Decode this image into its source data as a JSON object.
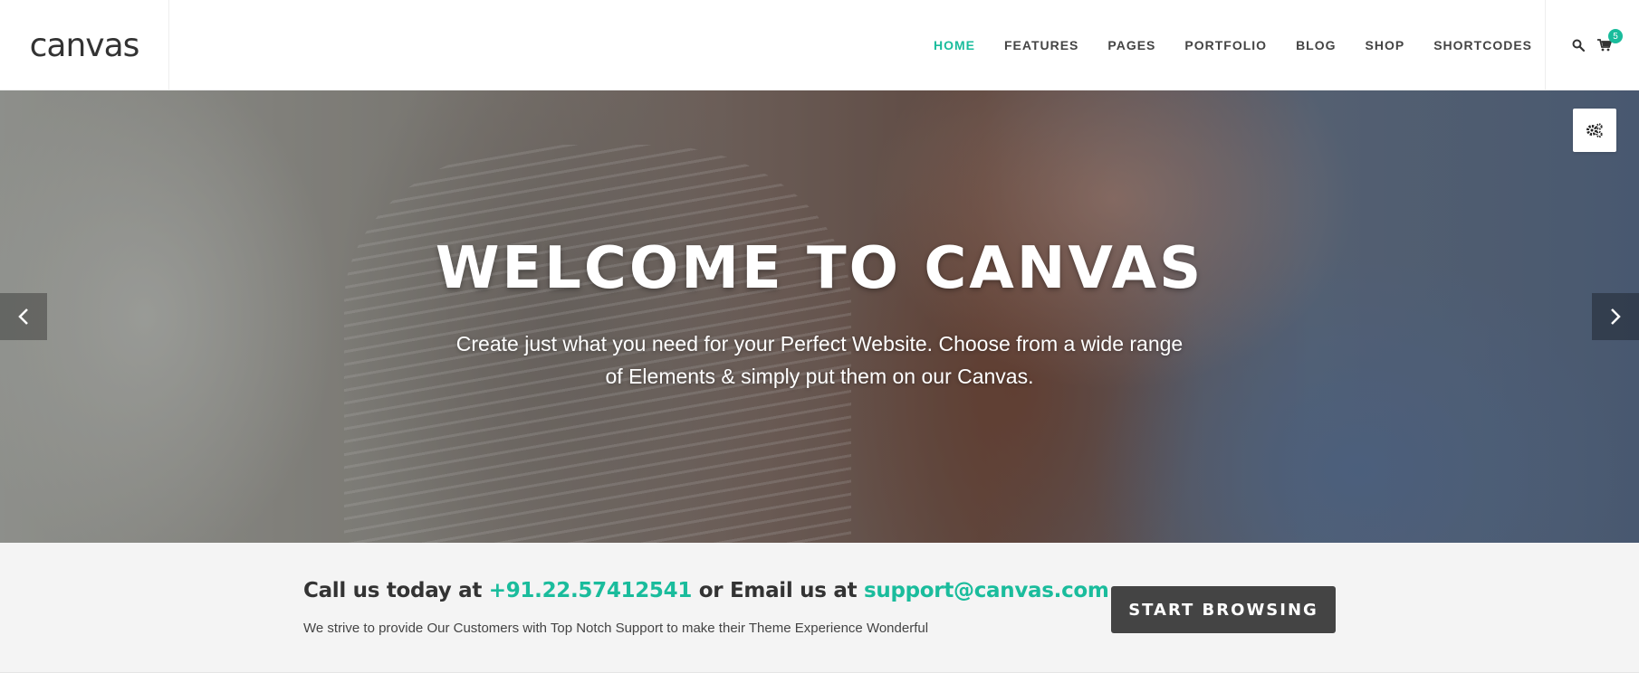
{
  "header": {
    "logo": "canvas",
    "nav": [
      {
        "label": "HOME",
        "active": true
      },
      {
        "label": "FEATURES",
        "active": false
      },
      {
        "label": "PAGES",
        "active": false
      },
      {
        "label": "PORTFOLIO",
        "active": false
      },
      {
        "label": "BLOG",
        "active": false
      },
      {
        "label": "SHOP",
        "active": false
      },
      {
        "label": "SHORTCODES",
        "active": false
      }
    ],
    "cart_count": "5",
    "icons": {
      "search": "search-icon",
      "cart": "cart-icon"
    }
  },
  "hero": {
    "title": "WELCOME TO CANVAS",
    "subtitle_line1": "Create just what you need for your Perfect Website. Choose from a wide range",
    "subtitle_line2": "of Elements & simply put them on our Canvas.",
    "icons": {
      "prev": "chevron-left-icon",
      "next": "chevron-right-icon",
      "settings": "gears-icon"
    }
  },
  "promo": {
    "heading_part1": "Call us today at ",
    "phone": "+91.22.57412541",
    "heading_part2": " or Email us at ",
    "email": "support@canvas.com",
    "text": "We strive to provide Our Customers with Top Notch Support to make their Theme Experience Wonderful",
    "button_label": "START BROWSING"
  },
  "colors": {
    "accent": "#1abc9c",
    "dark": "#444444",
    "promo_bg": "#f4f4f4"
  }
}
